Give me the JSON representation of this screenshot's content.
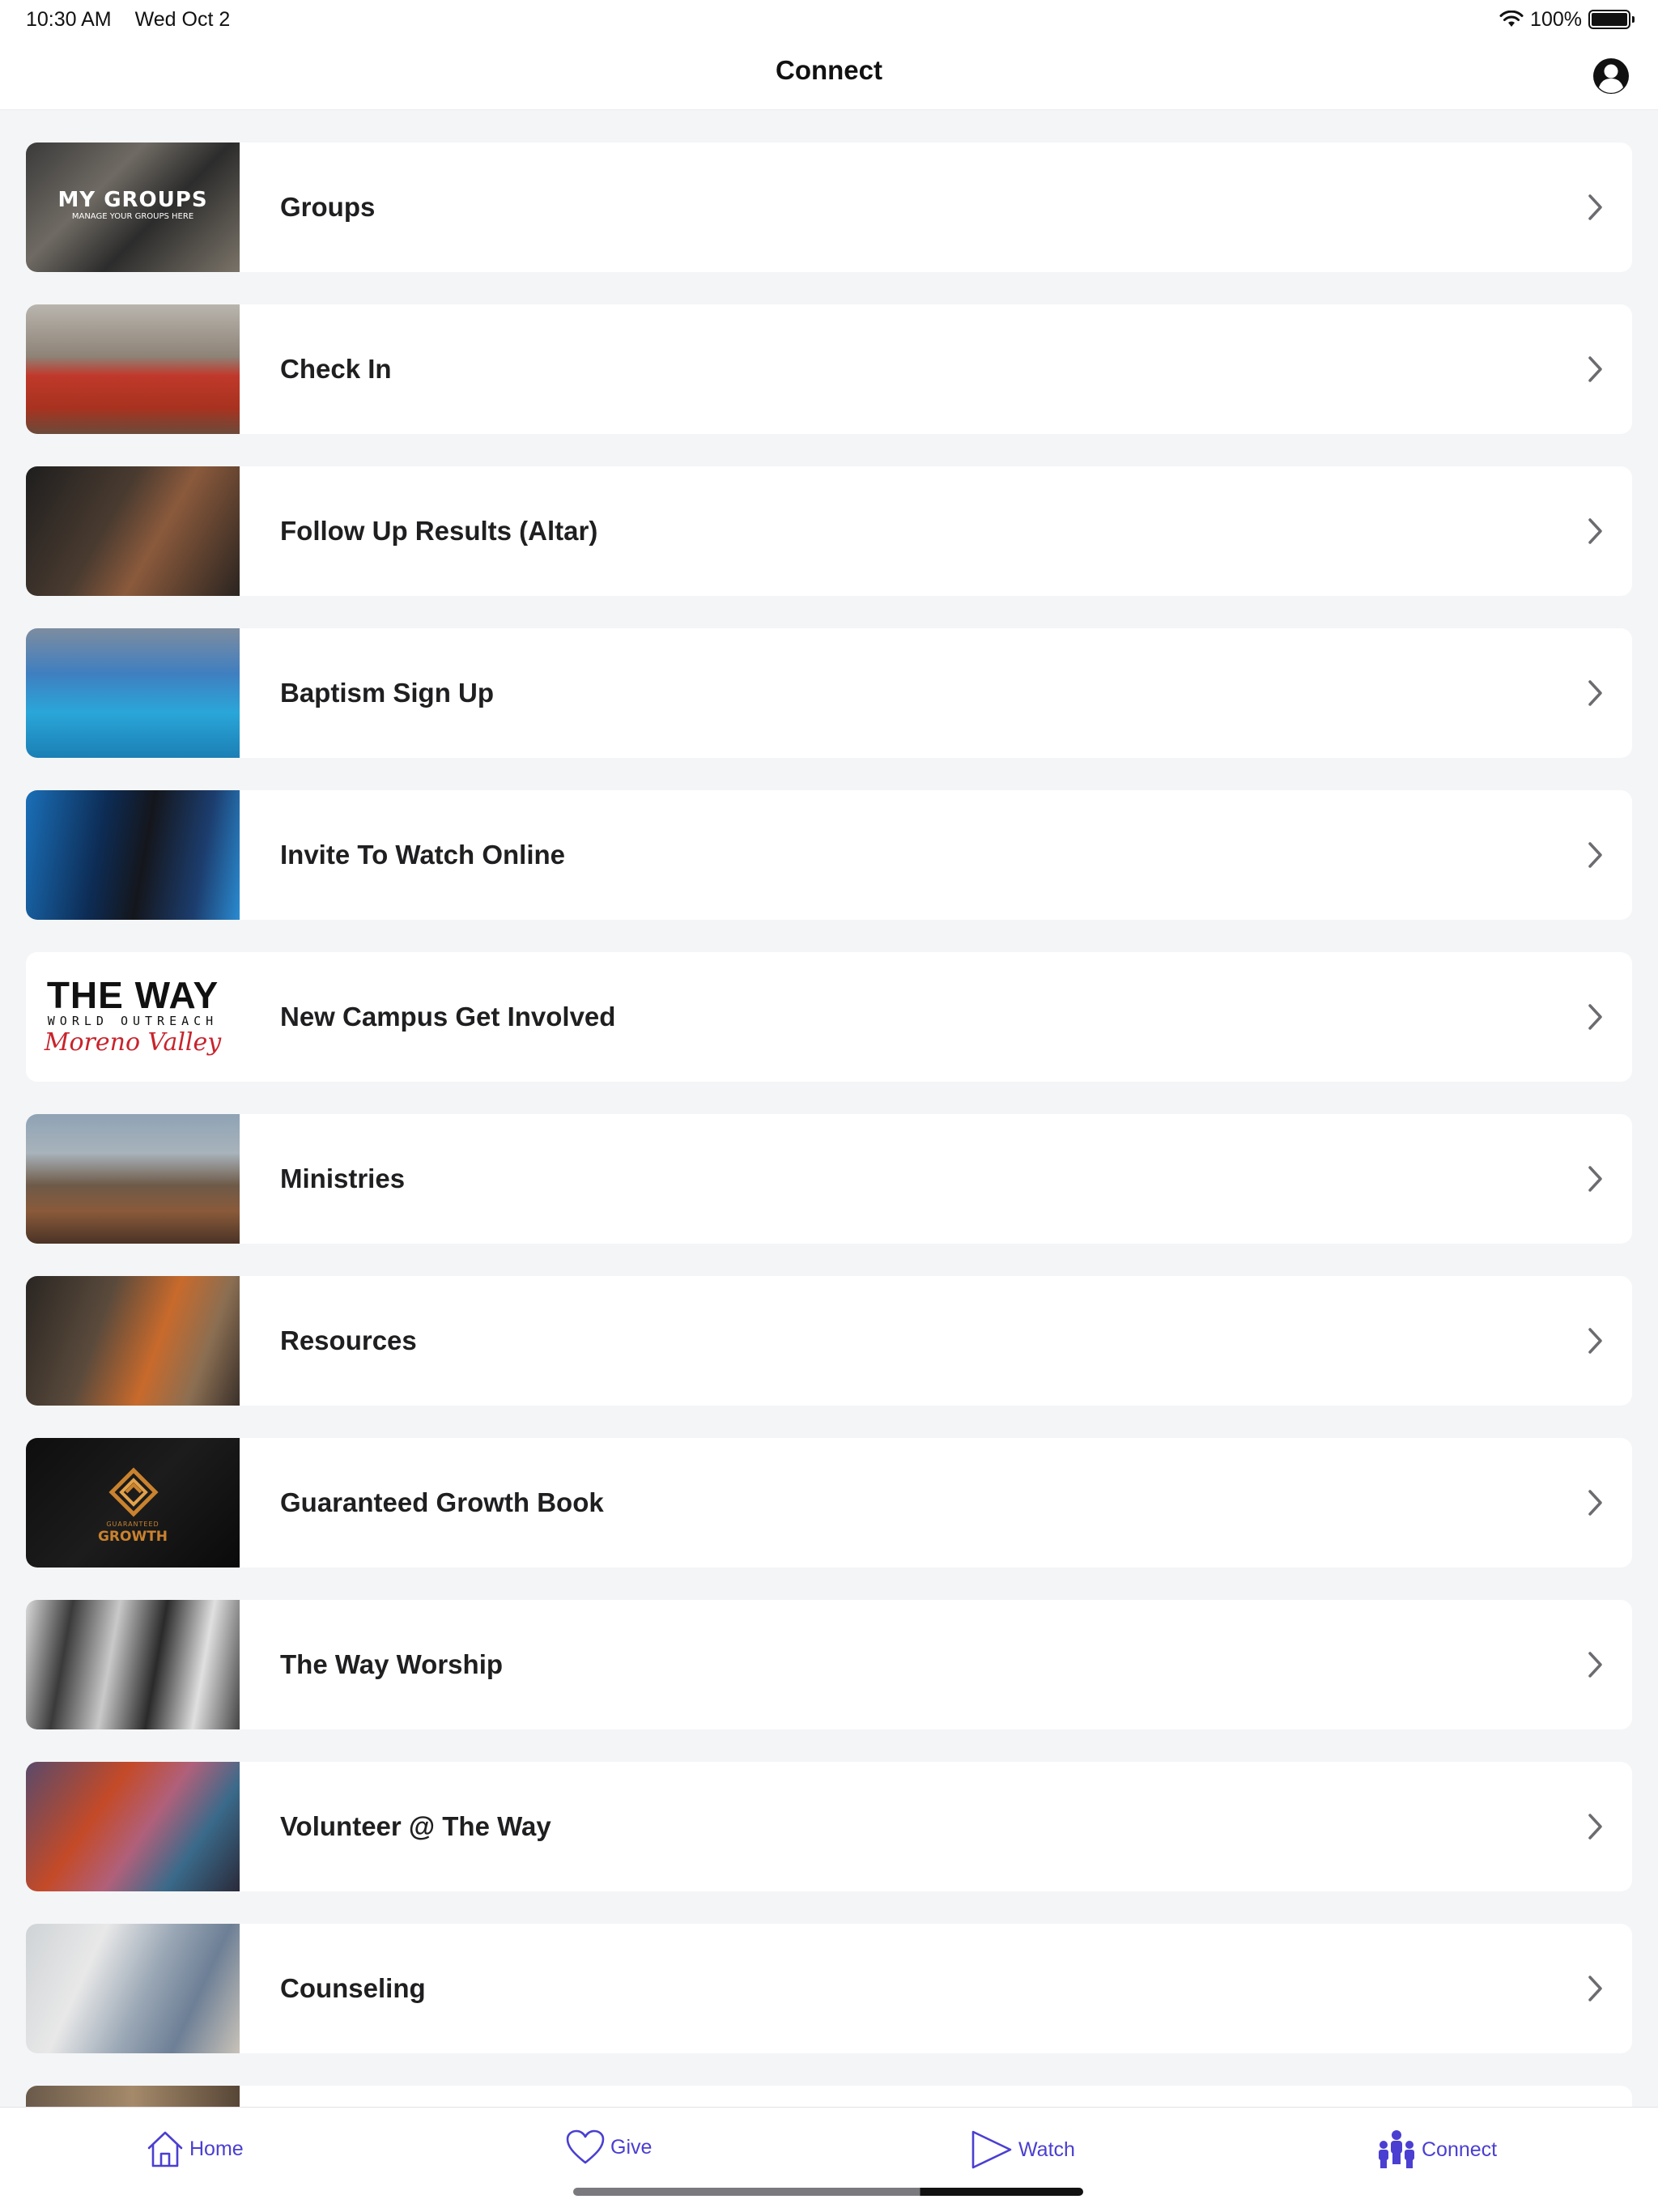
{
  "status_bar": {
    "time": "10:30 AM",
    "date": "Wed Oct 2",
    "battery": "100%",
    "battery_level": 1.0
  },
  "nav": {
    "title": "Connect",
    "profile_icon": "person-circle-icon"
  },
  "items": [
    {
      "label": "Groups",
      "thumb": "my-groups-photo",
      "thumb_title": "MY GROUPS",
      "thumb_subtitle": "MANAGE YOUR GROUPS HERE"
    },
    {
      "label": "Check In",
      "thumb": "volunteers-photo"
    },
    {
      "label": "Follow Up Results (Altar)",
      "thumb": "altar-prayer-photo"
    },
    {
      "label": "Baptism Sign Up",
      "thumb": "baptism-pool-photo"
    },
    {
      "label": "Invite To Watch Online",
      "thumb": "preacher-stage-photo"
    },
    {
      "label": "New Campus Get Involved",
      "thumb": "the-way-logo",
      "logo_main": "THE WAY",
      "logo_sub": "WORLD OUTREACH",
      "logo_script": "Moreno Valley"
    },
    {
      "label": "Ministries",
      "thumb": "crowd-worship-photo"
    },
    {
      "label": "Resources",
      "thumb": "food-drive-photo"
    },
    {
      "label": "Guaranteed Growth Book",
      "thumb": "guaranteed-growth-logo",
      "logo_small": "GUARANTEED",
      "logo_big": "GROWTH"
    },
    {
      "label": "The Way Worship",
      "thumb": "worship-team-photo"
    },
    {
      "label": "Volunteer @ The Way",
      "thumb": "volunteer-servant-photo"
    },
    {
      "label": "Counseling",
      "thumb": "counseling-session-photo"
    }
  ],
  "tabs": [
    {
      "label": "Home",
      "icon": "house-icon"
    },
    {
      "label": "Give",
      "icon": "heart-icon"
    },
    {
      "label": "Watch",
      "icon": "play-icon"
    },
    {
      "label": "Connect",
      "icon": "people-icon"
    }
  ],
  "colors": {
    "accent": "#4a3fd1",
    "background": "#f4f5f7",
    "card": "#ffffff"
  }
}
